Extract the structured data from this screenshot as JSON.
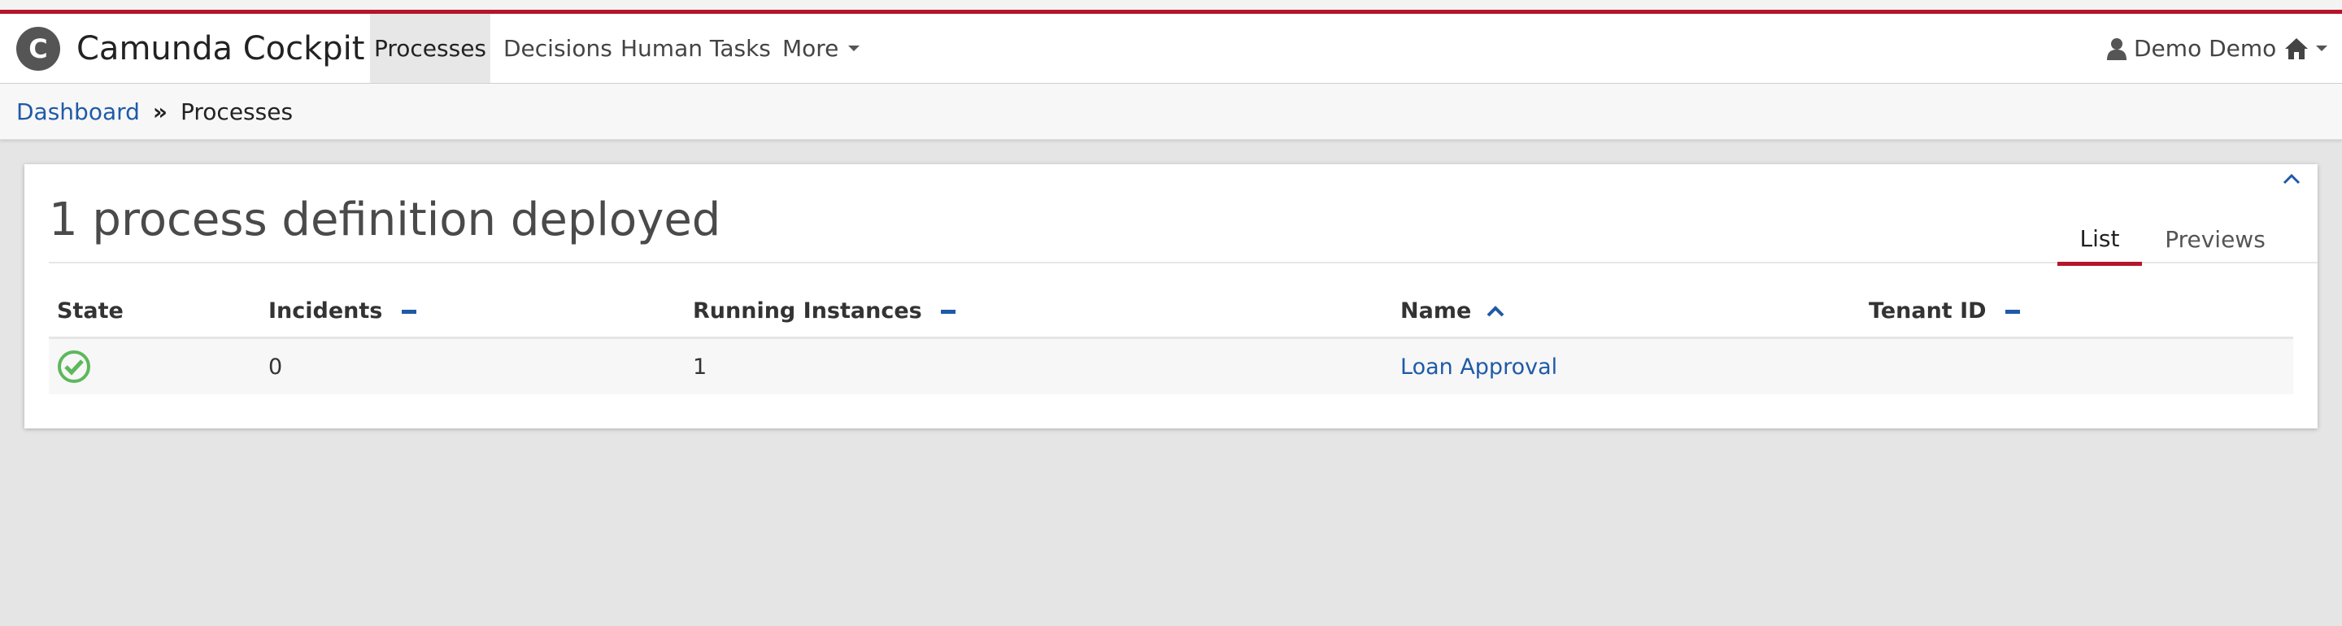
{
  "app": {
    "logo_letter": "C",
    "title": "Camunda Cockpit",
    "accent_color": "#b5152b",
    "link_color": "#1f5aa8"
  },
  "nav": {
    "items": [
      {
        "label": "Processes",
        "active": true
      },
      {
        "label": "Decisions",
        "active": false
      },
      {
        "label": "Human Tasks",
        "active": false
      },
      {
        "label": "More",
        "active": false
      }
    ],
    "user": {
      "icon": "user-icon",
      "name": "Demo Demo"
    },
    "home_icon": "home-icon"
  },
  "breadcrumb": {
    "items": [
      {
        "label": "Dashboard",
        "link": true
      },
      {
        "label": "Processes",
        "link": false
      }
    ],
    "separator": "»"
  },
  "panel": {
    "title": "1 process definition deployed",
    "collapse_icon": "chevron-up-icon",
    "tabs": [
      {
        "label": "List",
        "active": true
      },
      {
        "label": "Previews",
        "active": false
      }
    ]
  },
  "table": {
    "columns": [
      {
        "label": "State",
        "sort": "none"
      },
      {
        "label": "Incidents",
        "sort": "minus"
      },
      {
        "label": "Running Instances",
        "sort": "minus"
      },
      {
        "label": "Name",
        "sort": "ascending"
      },
      {
        "label": "Tenant ID",
        "sort": "minus"
      }
    ],
    "rows": [
      {
        "state_icon": "check-circle-icon",
        "state_color": "#5cb85c",
        "incidents": "0",
        "running_instances": "1",
        "name": "Loan Approval",
        "tenant_id": ""
      }
    ]
  }
}
